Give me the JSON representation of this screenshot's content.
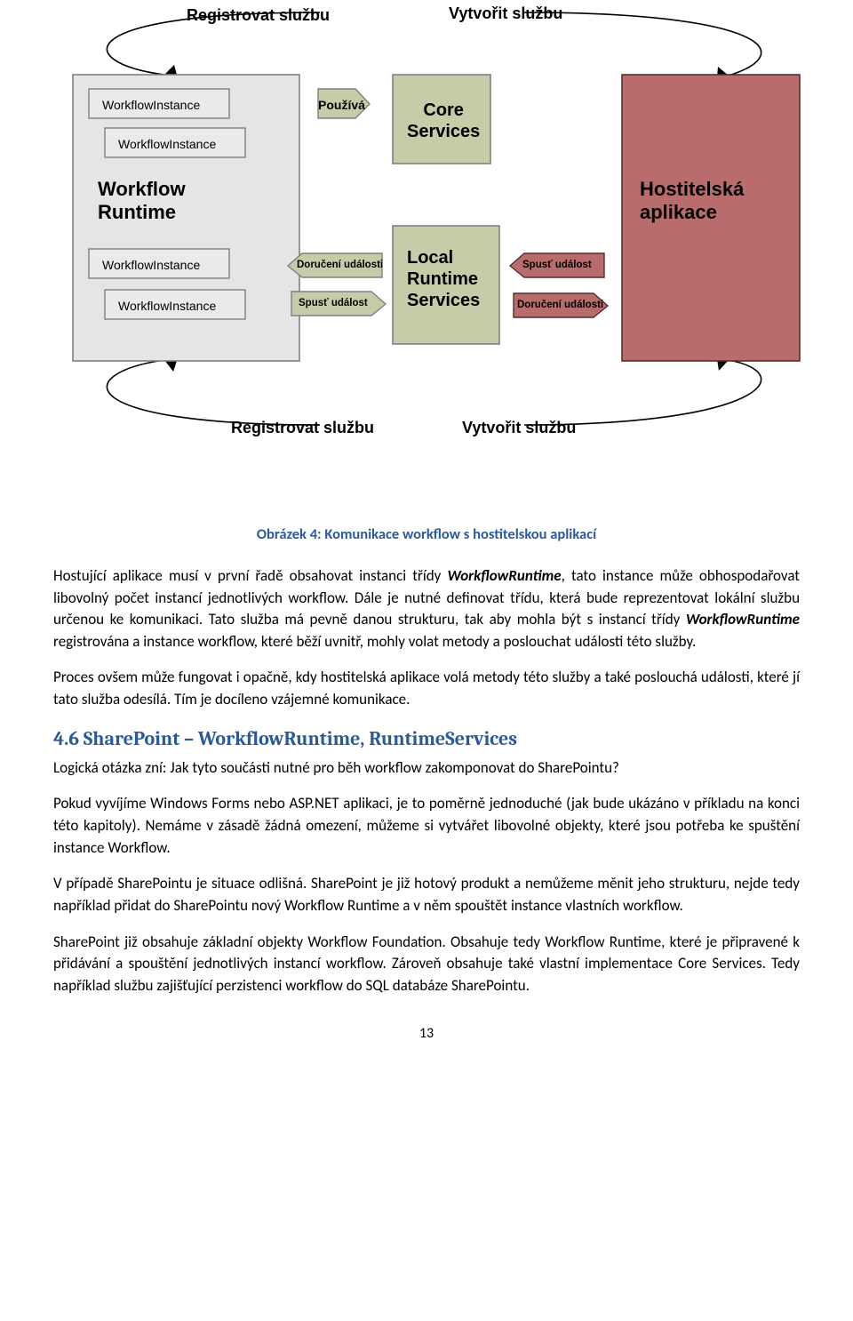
{
  "diagram": {
    "topLabels": {
      "register": "Registrovat službu",
      "create": "Vytvořit službu"
    },
    "bottomLabels": {
      "register": "Registrovat službu",
      "create": "Vytvořit službu"
    },
    "workflowBox": {
      "wi1": "WorkflowInstance",
      "wi2": "WorkflowInstance",
      "title": "Workflow\nRuntime",
      "wi3": "WorkflowInstance",
      "wi4": "WorkflowInstance"
    },
    "labelUses": "Používá",
    "coreServices": "Core\nServices",
    "localRuntime": "Local\nRuntime\nServices",
    "arrows": {
      "delivery1": "Doručení události",
      "spust1": "Spusť událost",
      "spust2": "Spusť událost",
      "delivery2": "Doručení události"
    },
    "hostApp": "Hostitelská\naplikace",
    "caption": "Obrázek 4: Komunikace workflow s hostitelskou aplikací"
  },
  "paragraphs": {
    "p1a": "Hostující aplikace musí v první řadě obsahovat instanci třídy ",
    "p1b": "WorkflowRuntime",
    "p1c": ", tato instance může obhospodařovat libovolný počet instancí jednotlivých workflow. Dále je nutné definovat třídu, která bude reprezentovat lokální službu určenou ke komunikaci. Tato služba má pevně danou strukturu, tak aby mohla být s instancí třídy ",
    "p1d": "WorkflowRuntime",
    "p1e": " registrována a instance workflow, které běží uvnitř, mohly volat metody a poslouchat události této služby.",
    "p2": "Proces ovšem může fungovat i opačně, kdy hostitelská aplikace volá metody této služby a také poslouchá události, které jí tato služba odesílá. Tím je docíleno vzájemné komunikace.",
    "p3": "Logická otázka zní: Jak tyto součásti nutné pro běh workflow zakomponovat do SharePointu?",
    "p4": "Pokud vyvíjíme Windows Forms nebo ASP.NET aplikaci, je to poměrně jednoduché (jak bude ukázáno v příkladu na konci této kapitoly). Nemáme v zásadě žádná omezení, můžeme si vytvářet libovolné objekty, které jsou potřeba ke spuštění instance Workflow.",
    "p5": "V případě SharePointu je situace odlišná. SharePoint je již hotový produkt a nemůžeme měnit jeho strukturu, nejde tedy například přidat do SharePointu nový Workflow Runtime a v něm spouštět instance vlastních workflow.",
    "p6": "SharePoint již obsahuje základní objekty Workflow Foundation. Obsahuje tedy Workflow Runtime, které je připravené k přidávání a spouštění jednotlivých instancí workflow. Zároveň obsahuje také vlastní implementace Core Services. Tedy například službu zajišťující perzistenci workflow do SQL databáze SharePointu."
  },
  "heading": "4.6  SharePoint – WorkflowRuntime, RuntimeServices",
  "pageNumber": "13"
}
